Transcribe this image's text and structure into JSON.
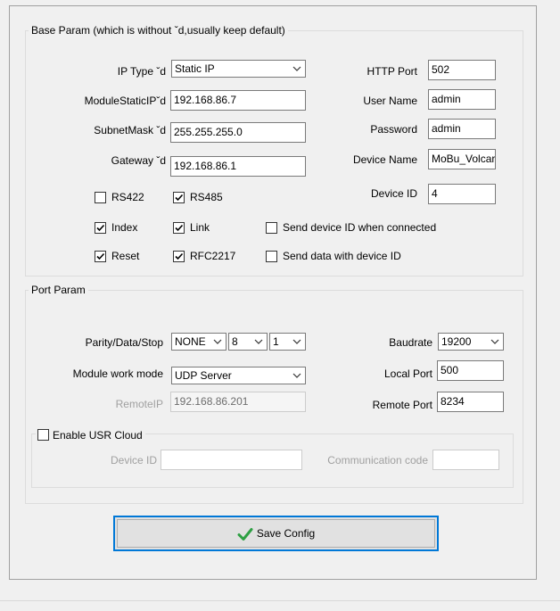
{
  "base_param": {
    "legend": "Base Param (which is without ˇd,usually keep default)",
    "ip_type": {
      "label": "IP Type ˇd",
      "value": "Static IP"
    },
    "module_static_ip": {
      "label": "ModuleStaticIPˇd",
      "value": "192.168.86.7"
    },
    "subnet_mask": {
      "label": "SubnetMask ˇd",
      "value": "255.255.255.0"
    },
    "gateway": {
      "label": "Gateway ˇd",
      "value": "192.168.86.1"
    },
    "http_port": {
      "label": "HTTP Port",
      "value": "502"
    },
    "user_name": {
      "label": "User Name",
      "value": "admin"
    },
    "password": {
      "label": "Password",
      "value": "admin"
    },
    "device_name": {
      "label": "Device Name",
      "value": "MoBu_Volcar"
    },
    "device_id": {
      "label": "Device ID",
      "value": "4"
    },
    "rs422": {
      "label": "RS422",
      "checked": false
    },
    "rs485": {
      "label": "RS485",
      "checked": true
    },
    "index": {
      "label": "Index",
      "checked": true
    },
    "link": {
      "label": "Link",
      "checked": true
    },
    "reset": {
      "label": "Reset",
      "checked": true
    },
    "rfc2217": {
      "label": "RFC2217",
      "checked": true
    },
    "send_id_connected": {
      "label": "Send device ID when connected",
      "checked": false
    },
    "send_data_with_id": {
      "label": "Send data with device ID",
      "checked": false
    }
  },
  "port_param": {
    "legend": "Port Param",
    "parity_label": "Parity/Data/Stop",
    "parity": "NONE",
    "data_bits": "8",
    "stop_bits": "1",
    "baudrate": {
      "label": "Baudrate",
      "value": "19200"
    },
    "work_mode": {
      "label": "Module work mode",
      "value": "UDP Server"
    },
    "local_port": {
      "label": "Local Port",
      "value": "500"
    },
    "remote_ip": {
      "label": "RemoteIP",
      "value": "192.168.86.201"
    },
    "remote_port": {
      "label": "Remote Port",
      "value": "8234"
    },
    "usr_cloud": {
      "label": "Enable USR Cloud",
      "checked": false,
      "device_id_label": "Device ID",
      "device_id_value": "",
      "comm_code_label": "Communication code",
      "comm_code_value": ""
    }
  },
  "save_button": {
    "label": "Save Config",
    "icon": "checkmark-icon",
    "icon_color": "#2ea043"
  },
  "accent_color": "#0078d7"
}
